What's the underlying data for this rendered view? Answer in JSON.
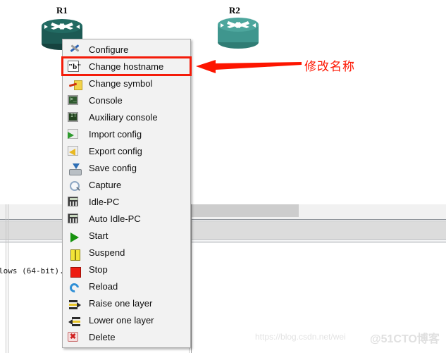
{
  "canvas": {
    "background_color": "#ffffff",
    "devices": [
      {
        "label": "R1",
        "symbol": "router-icon",
        "color": "#1d5a54"
      },
      {
        "label": "R2",
        "symbol": "router-icon",
        "color": "#3f968e"
      }
    ]
  },
  "context_menu": {
    "highlight_color": "#f41b09",
    "background_color": "#f2f2f2",
    "items": [
      {
        "label": "Configure",
        "icon": "wrench-screwdriver-icon",
        "highlighted": false
      },
      {
        "label": "Change hostname",
        "icon": "rename-text-icon",
        "highlighted": true
      },
      {
        "label": "Change symbol",
        "icon": "scissors-image-icon",
        "highlighted": false
      },
      {
        "label": "Console",
        "icon": "terminal-icon",
        "highlighted": false
      },
      {
        "label": "Auxiliary console",
        "icon": "terminal-aux-icon",
        "highlighted": false
      },
      {
        "label": "Import config",
        "icon": "import-arrow-icon",
        "highlighted": false
      },
      {
        "label": "Export config",
        "icon": "export-arrow-icon",
        "highlighted": false
      },
      {
        "label": "Save config",
        "icon": "save-disk-icon",
        "highlighted": false
      },
      {
        "label": "Capture",
        "icon": "magnifier-icon",
        "highlighted": false
      },
      {
        "label": "Idle-PC",
        "icon": "calculator-icon",
        "highlighted": false
      },
      {
        "label": "Auto Idle-PC",
        "icon": "calculator-icon",
        "highlighted": false
      },
      {
        "label": "Start",
        "icon": "play-icon",
        "highlighted": false
      },
      {
        "label": "Suspend",
        "icon": "pause-icon",
        "highlighted": false
      },
      {
        "label": "Stop",
        "icon": "stop-icon",
        "highlighted": false
      },
      {
        "label": "Reload",
        "icon": "reload-icon",
        "highlighted": false
      },
      {
        "label": "Raise one layer",
        "icon": "raise-layer-icon",
        "highlighted": false
      },
      {
        "label": "Lower one layer",
        "icon": "lower-layer-icon",
        "highlighted": false
      },
      {
        "label": "Delete",
        "icon": "delete-icon",
        "highlighted": false
      }
    ]
  },
  "annotation": {
    "text": "修改名称",
    "color": "#fd1500",
    "arrow": "left-arrow-icon"
  },
  "console_panel": {
    "visible_text": "lows (64-bit)."
  },
  "watermarks": {
    "url": "https://blog.csdn.net/wei",
    "brand": "@51CTO博客"
  },
  "icon_glyphs": {
    "hostname": "\"b\"",
    "console": ">_",
    "aux": "IT",
    "delete": "✖"
  }
}
